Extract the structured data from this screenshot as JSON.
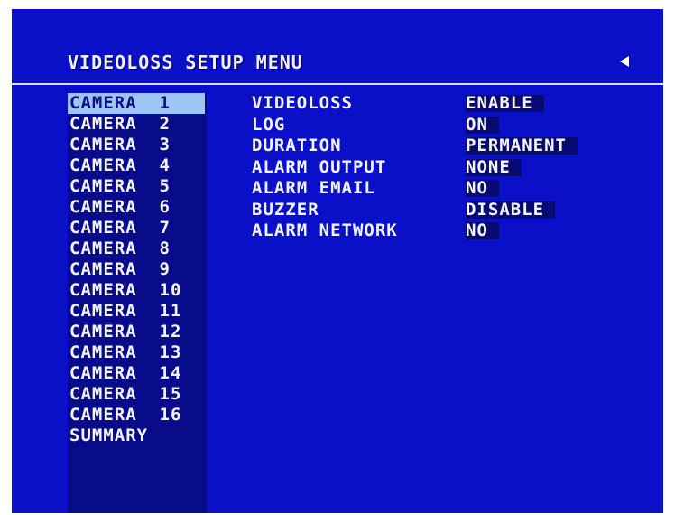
{
  "menu": {
    "title": "VIDEOLOSS SETUP MENU",
    "back_icon": "left-triangle-icon"
  },
  "cameras": {
    "selected_index": 0,
    "items": [
      "CAMERA  1",
      "CAMERA  2",
      "CAMERA  3",
      "CAMERA  4",
      "CAMERA  5",
      "CAMERA  6",
      "CAMERA  7",
      "CAMERA  8",
      "CAMERA  9",
      "CAMERA  10",
      "CAMERA  11",
      "CAMERA  12",
      "CAMERA  13",
      "CAMERA  14",
      "CAMERA  15",
      "CAMERA  16",
      "SUMMARY"
    ]
  },
  "settings": [
    {
      "label": "VIDEOLOSS",
      "value": "ENABLE"
    },
    {
      "label": "LOG",
      "value": "ON"
    },
    {
      "label": "DURATION",
      "value": "PERMANENT"
    },
    {
      "label": "ALARM OUTPUT",
      "value": "NONE"
    },
    {
      "label": "ALARM EMAIL",
      "value": "NO"
    },
    {
      "label": "BUZZER",
      "value": "DISABLE"
    },
    {
      "label": "ALARM NETWORK",
      "value": "NO"
    }
  ],
  "colors": {
    "background": "#0a10c8",
    "list_background": "#080c8a",
    "highlight": "#9ec6f4",
    "text": "#f4f4ff"
  }
}
